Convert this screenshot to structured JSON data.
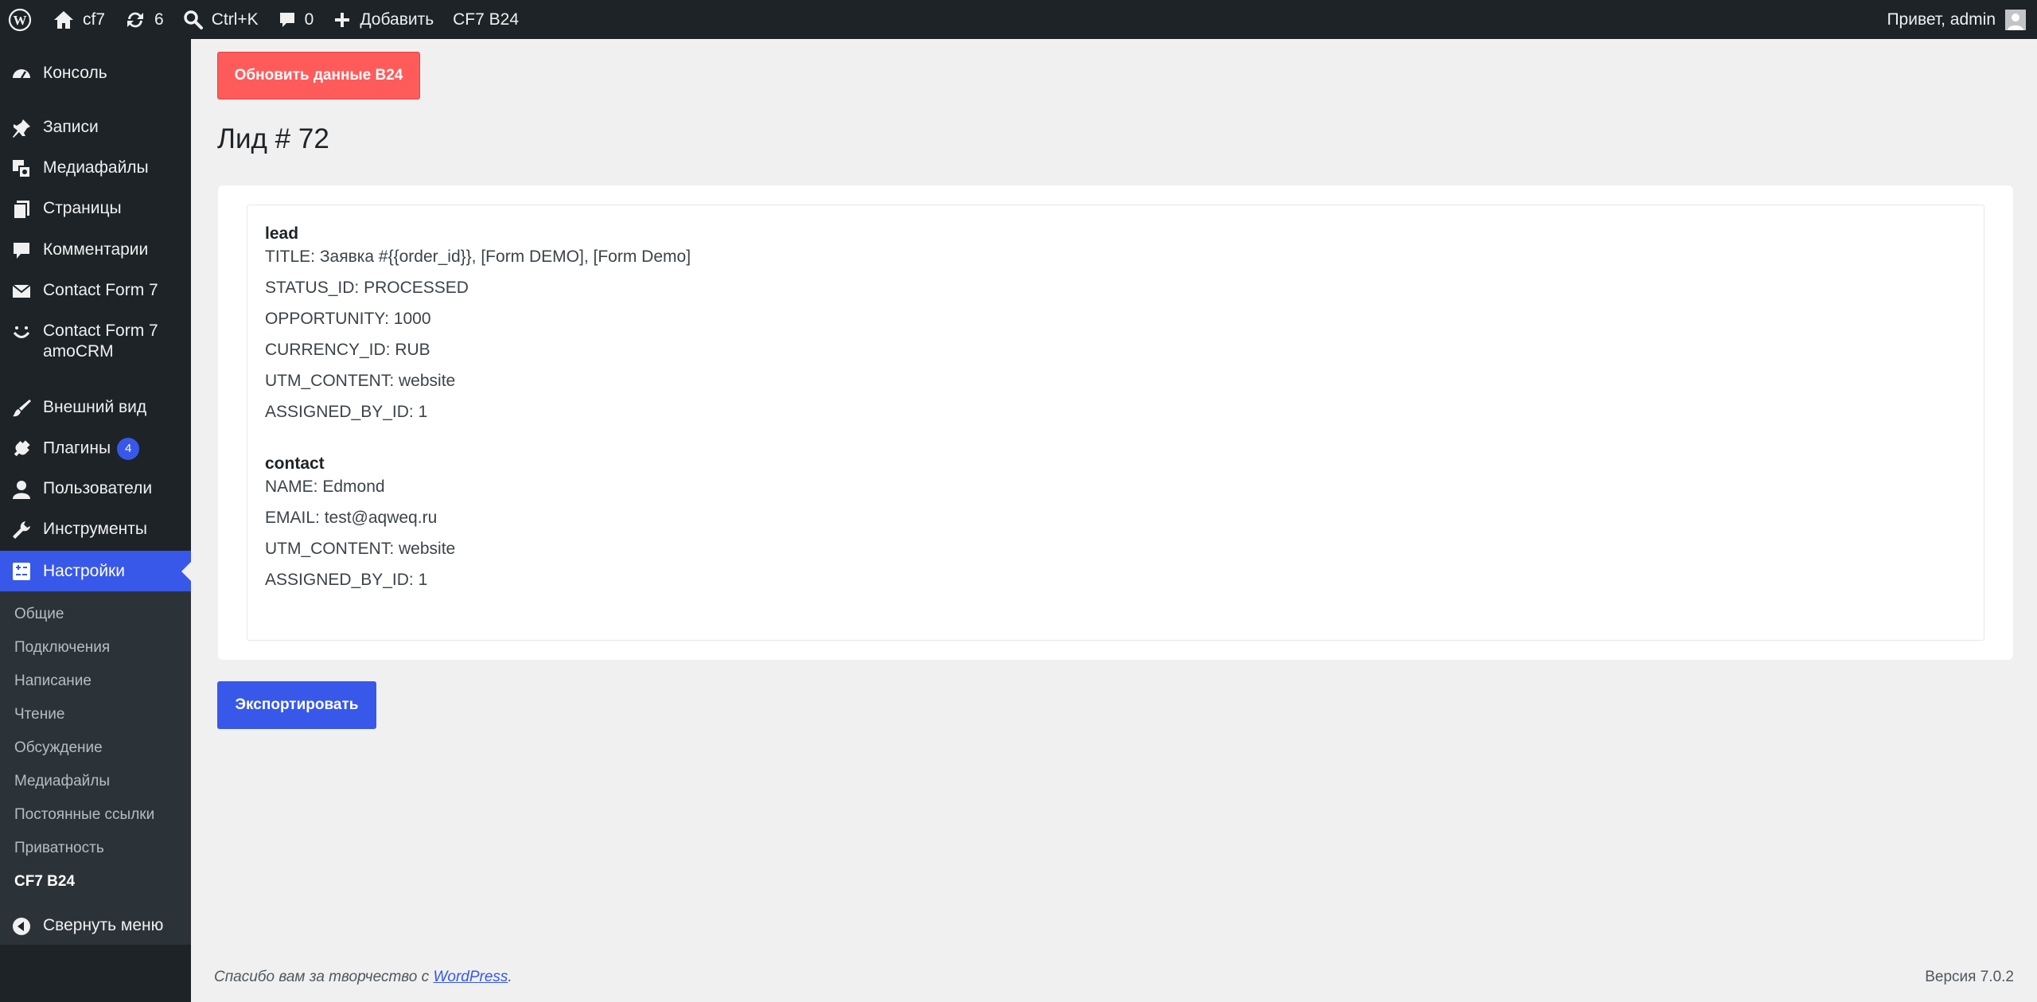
{
  "adminbar": {
    "site_name": "cf7",
    "updates_count": "6",
    "search_label": "Ctrl+K",
    "comments_count": "0",
    "add_new_label": "Добавить",
    "plugin_link": "CF7 B24",
    "greeting": "Привет, admin"
  },
  "sidebar": {
    "items": [
      {
        "label": "Консоль",
        "icon": "dashboard-icon"
      },
      {
        "label": "Записи",
        "icon": "pin-icon"
      },
      {
        "label": "Медиафайлы",
        "icon": "media-icon"
      },
      {
        "label": "Страницы",
        "icon": "pages-icon"
      },
      {
        "label": "Комментарии",
        "icon": "comment-icon"
      },
      {
        "label": "Contact Form 7",
        "icon": "mail-icon"
      },
      {
        "label": "Contact Form 7 amoCRM",
        "icon": "smile-icon"
      },
      {
        "label": "Внешний вид",
        "icon": "brush-icon"
      },
      {
        "label": "Плагины",
        "icon": "plugin-icon",
        "badge": "4"
      },
      {
        "label": "Пользователи",
        "icon": "user-icon"
      },
      {
        "label": "Инструменты",
        "icon": "wrench-icon"
      },
      {
        "label": "Настройки",
        "icon": "settings-icon"
      }
    ],
    "submenu": [
      "Общие",
      "Подключения",
      "Написание",
      "Чтение",
      "Обсуждение",
      "Медиафайлы",
      "Постоянные ссылки",
      "Приватность",
      "CF7 B24"
    ],
    "collapse_label": "Свернуть меню"
  },
  "main": {
    "refresh_button": "Обновить данные B24",
    "title": "Лид # 72",
    "lead": {
      "heading": "lead",
      "fields": [
        "TITLE: Заявка #{{order_id}}, [Form DEMO], [Form Demo]",
        "STATUS_ID: PROCESSED",
        "OPPORTUNITY: 1000",
        "CURRENCY_ID: RUB",
        "UTM_CONTENT: website",
        "ASSIGNED_BY_ID: 1"
      ]
    },
    "contact": {
      "heading": "contact",
      "fields": [
        "NAME: Edmond",
        "EMAIL: test@aqweq.ru",
        "UTM_CONTENT: website",
        "ASSIGNED_BY_ID: 1"
      ]
    },
    "export_button": "Экспортировать"
  },
  "footer": {
    "thanks_text": "Спасибо вам за творчество с ",
    "wp_link": "WordPress",
    "period": ".",
    "version": "Версия 7.0.2"
  },
  "colors": {
    "accent": "#3858e9",
    "refresh_button": "#ff5b5b",
    "sidebar_bg": "#1d2327"
  }
}
